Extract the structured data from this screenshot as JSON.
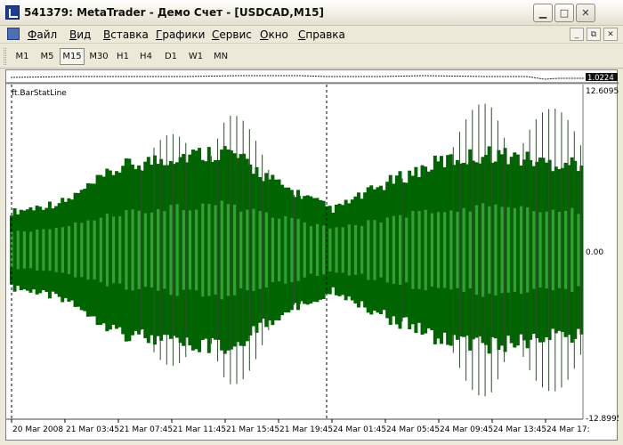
{
  "window": {
    "title": "541379: MetaTrader - Демо Счет - [USDCAD,M15]",
    "buttons": {
      "minimize": "▁",
      "maximize": "□",
      "close": "✕"
    }
  },
  "menu": {
    "items": [
      "Файл",
      "Вид",
      "Вставка",
      "Графики",
      "Сервис",
      "Окно",
      "Справка"
    ],
    "doc_buttons": {
      "minimize": "_",
      "restore": "⧉",
      "close": "✕"
    }
  },
  "toolbar": {
    "timeframes": [
      "M1",
      "M5",
      "M15",
      "M30",
      "H1",
      "H4",
      "D1",
      "W1",
      "MN"
    ],
    "active": "M15"
  },
  "chart": {
    "top_panel_value": "1.0224",
    "indicator_label": "ft.BarStatLine",
    "right_scale": [
      "12.6095",
      "0.00",
      "-12.8995"
    ],
    "x_labels": [
      "20 Mar 2008",
      "21 Mar 03:45",
      "21 Mar 07:45",
      "21 Mar 11:45",
      "21 Mar 15:45",
      "21 Mar 19:45",
      "24 Mar 01:45",
      "24 Mar 05:45",
      "24 Mar 09:45",
      "24 Mar 13:45",
      "24 Mar 17:"
    ],
    "colors": {
      "dark_bar": "#006400",
      "light_bar": "#32a032",
      "spike": "#2f4f2f",
      "bg": "#ffffff"
    }
  },
  "chart_data": {
    "type": "bar",
    "title": "ft.BarStatLine",
    "xlabel": "",
    "ylabel": "",
    "ylim": [
      -12.8995,
      12.6095
    ],
    "categories": [
      "20 Mar 2008",
      "21 Mar 03:45",
      "21 Mar 07:45",
      "21 Mar 11:45",
      "21 Mar 15:45",
      "21 Mar 19:45",
      "24 Mar 01:45",
      "24 Mar 05:45",
      "24 Mar 09:45",
      "24 Mar 13:45",
      "24 Mar 17:"
    ],
    "series": [
      {
        "values": [
          3.2,
          4.1,
          6.9,
          7.8,
          8.3,
          5.4,
          3.4,
          5.6,
          7.4,
          8.1,
          7.3
        ]
      },
      {
        "values": [
          1.6,
          1.9,
          3.1,
          3.6,
          3.8,
          2.8,
          1.7,
          2.6,
          3.4,
          3.7,
          3.3
        ]
      },
      {
        "values": [
          1.0,
          1.8,
          6.7,
          9.0,
          11.2,
          7.0,
          1.4,
          4.2,
          8.5,
          12.1,
          10.8
        ]
      }
    ]
  }
}
